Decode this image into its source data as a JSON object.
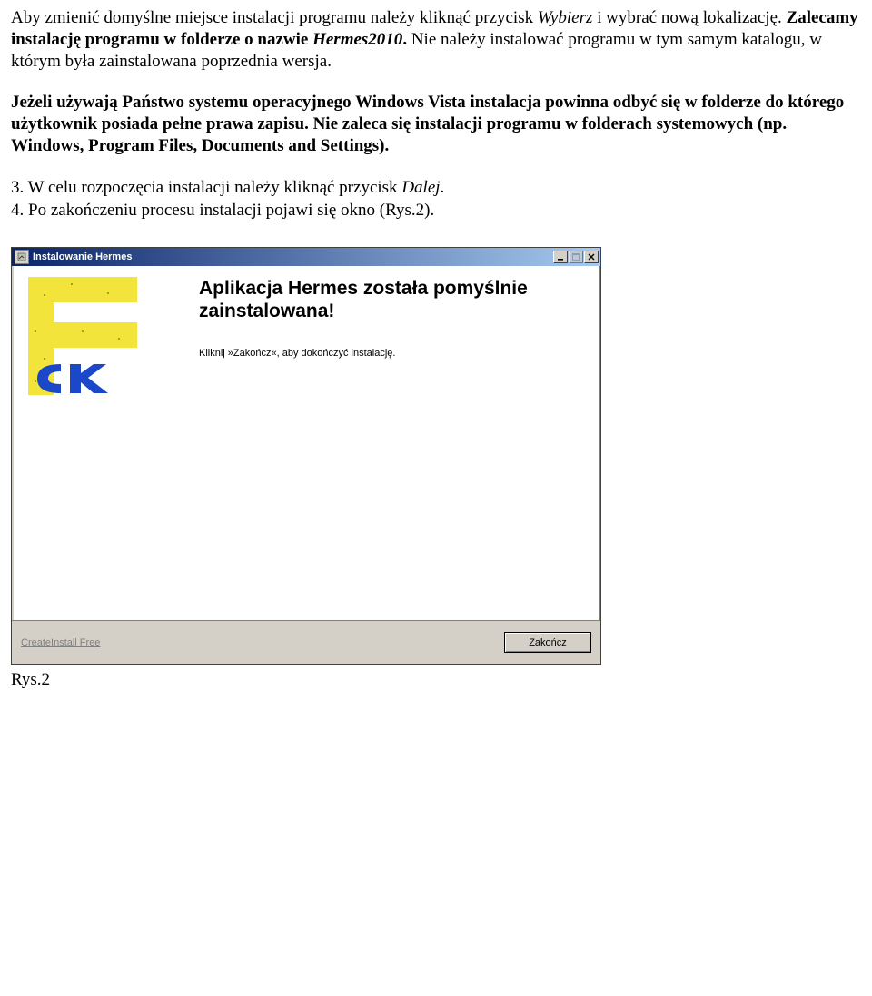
{
  "para1": {
    "pre": "Aby zmienić domyślne miejsce instalacji programu należy kliknąć przycisk ",
    "italic1": "Wybierz",
    "mid1": " i wybrać nową lokalizację. ",
    "bold1": "Zalecamy instalację programu w folderze o nazwie ",
    "bolditalic1": "Hermes2010",
    "bold_dot": ".",
    "post": " Nie należy instalować programu w tym samym katalogu, w którym była zainstalowana poprzednia wersja."
  },
  "para2": "Jeżeli używają Państwo systemu operacyjnego Windows Vista instalacja powinna odbyć się w folderze do którego użytkownik posiada pełne prawa zapisu. Nie zaleca się instalacji programu w folderach systemowych (np. Windows, Program Files, Documents and Settings).",
  "step3": {
    "pre": "3. W celu rozpoczęcia instalacji należy kliknąć przycisk ",
    "italic": "Dalej",
    "post": "."
  },
  "step4": "4. Po zakończeniu procesu instalacji pojawi się okno (Rys.2).",
  "window": {
    "title": "Instalowanie Hermes",
    "headline": "Aplikacja Hermes została pomyślnie zainstalowana!",
    "subline": "Kliknij »Zakończ«, aby dokończyć instalację.",
    "footer_left": "CreateInstall Free",
    "close_button": "Zakończ"
  },
  "caption": "Rys.2"
}
